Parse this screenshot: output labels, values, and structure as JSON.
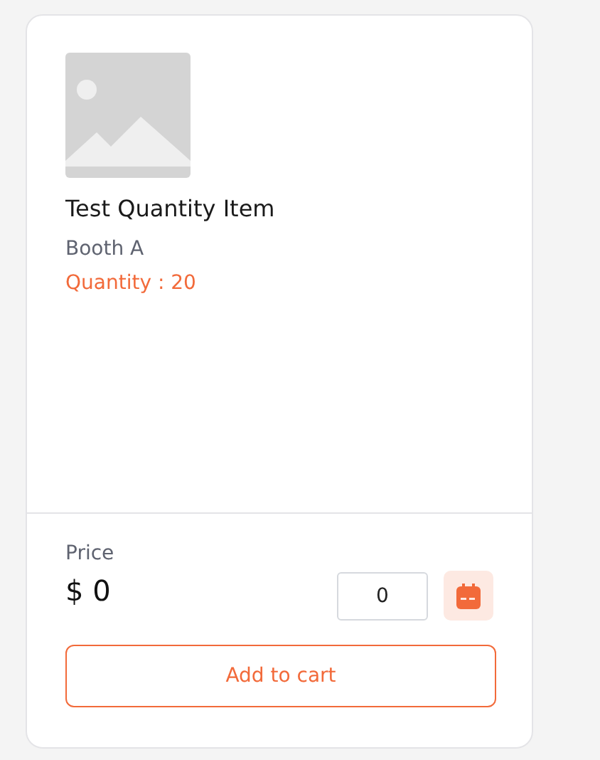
{
  "product": {
    "name": "Test Quantity Item",
    "booth": "Booth A",
    "quantity": "Quantity : 20"
  },
  "footer": {
    "price_label": "Price",
    "price": "$ 0",
    "quantity_value": "0",
    "add_button": "Add to cart"
  }
}
